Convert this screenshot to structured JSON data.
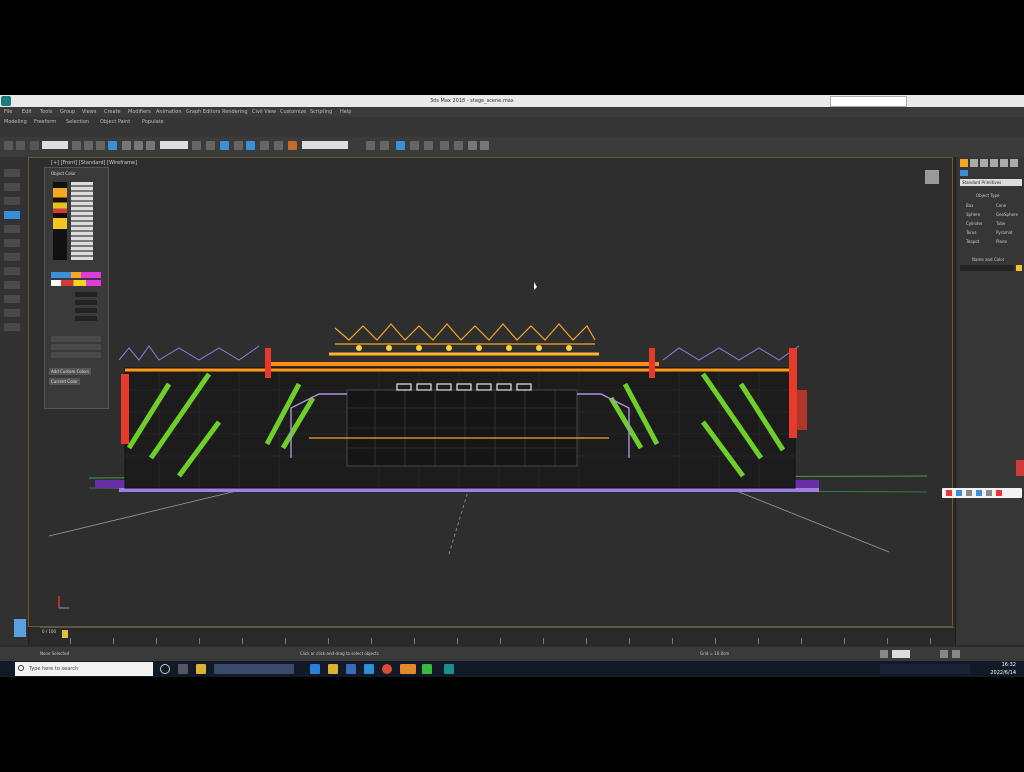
{
  "window": {
    "title": "3ds Max 2018 - stage_scene.max"
  },
  "menu": {
    "items": [
      "File",
      "Edit",
      "Tools",
      "Group",
      "Views",
      "Create",
      "Modifiers",
      "Animation",
      "Graph Editors",
      "Rendering",
      "Civil View",
      "Customize",
      "Scripting",
      "Help"
    ]
  },
  "ribbon": {
    "tabs": [
      "Modeling",
      "Freeform",
      "Selection",
      "Object Paint",
      "Populate"
    ]
  },
  "viewport": {
    "label": "[+] [Front] [Standard] [Wireframe]"
  },
  "float_panel": {
    "title": "Object Color",
    "buttons": [
      "Add Custom Colors",
      "Current Color"
    ]
  },
  "command_panel": {
    "title": "Standard Primitives",
    "rollout_a": "Object Type",
    "rollout_b": "Name and Color",
    "objects": [
      "Box",
      "Cone",
      "Sphere",
      "GeoSphere",
      "Cylinder",
      "Tube",
      "Torus",
      "Pyramid",
      "Teapot",
      "Plane"
    ]
  },
  "timeline": {
    "frame": "0 / 100"
  },
  "status": {
    "left": "None Selected",
    "prompt": "Click or click-and-drag to select objects",
    "grid": "Grid = 10.0cm"
  },
  "taskbar": {
    "search_placeholder": "Type here to search",
    "time": "16:32",
    "date": "2022/6/14"
  },
  "colors": {
    "accent": "#3a8fd8",
    "orange": "#f5a623",
    "green": "#6ecf2b"
  }
}
